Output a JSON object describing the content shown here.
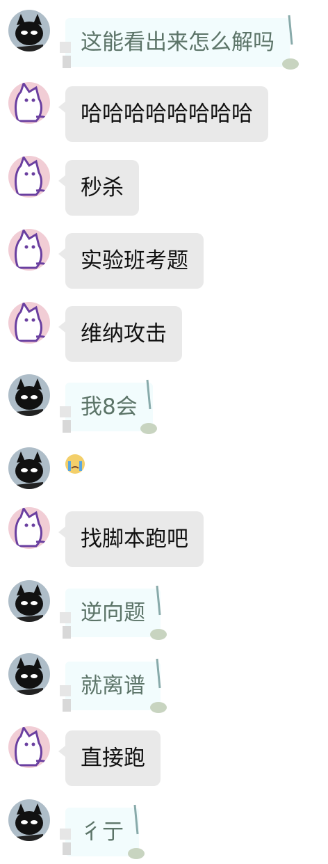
{
  "messages": [
    {
      "sender": "black-cat",
      "style": "cute",
      "text": "这能看出来怎么解吗"
    },
    {
      "sender": "purple-cat",
      "style": "gray",
      "text": "哈哈哈哈哈哈哈哈"
    },
    {
      "sender": "purple-cat",
      "style": "gray",
      "text": "秒杀"
    },
    {
      "sender": "purple-cat",
      "style": "gray",
      "text": "实验班考题"
    },
    {
      "sender": "purple-cat",
      "style": "gray",
      "text": "维纳攻击"
    },
    {
      "sender": "black-cat",
      "style": "cute",
      "text": "我8会"
    },
    {
      "sender": "black-cat",
      "style": "sticker",
      "text": ""
    },
    {
      "sender": "purple-cat",
      "style": "gray",
      "text": "找脚本跑吧"
    },
    {
      "sender": "black-cat",
      "style": "cute",
      "text": "逆向题"
    },
    {
      "sender": "black-cat",
      "style": "cute",
      "text": "就离谱"
    },
    {
      "sender": "purple-cat",
      "style": "gray",
      "text": "直接跑"
    },
    {
      "sender": "black-cat",
      "style": "cute",
      "text": "彳亍"
    }
  ],
  "colors": {
    "gray_bubble": "#e9e9e9",
    "cute_bubble": "#f2fcfd",
    "cute_text": "#5c7468",
    "black_avatar_bg": "#aebdc8",
    "purple_avatar_bg": "#f1cdd5"
  }
}
